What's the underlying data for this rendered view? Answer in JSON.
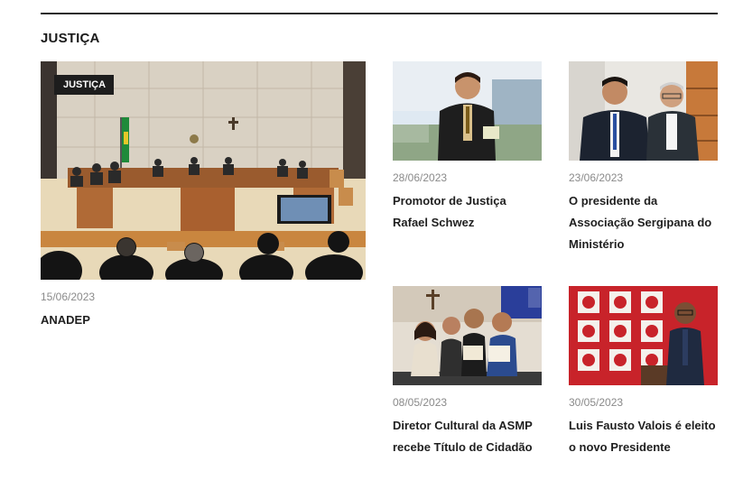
{
  "section": {
    "title": "JUSTIÇA"
  },
  "featured": {
    "badge": "JUSTIÇA",
    "date": "15/06/2023",
    "title": "ANADEP"
  },
  "articles": [
    {
      "date": "28/06/2023",
      "title_line1": "Promotor de Justiça",
      "title_line2": "Rafael Schwez",
      "title_line3": ""
    },
    {
      "date": "23/06/2023",
      "title_line1": "O presidente da",
      "title_line2": "Associação Sergipana do",
      "title_line3": "Ministério"
    },
    {
      "date": "08/05/2023",
      "title_line1": "Diretor Cultural da ASMP",
      "title_line2": "recebe Título de Cidadão",
      "title_line3": ""
    },
    {
      "date": "30/05/2023",
      "title_line1": "Luis Fausto Valois é eleito",
      "title_line2": "o novo Presidente",
      "title_line3": ""
    }
  ],
  "colors": {
    "rule": "#2b2b2b",
    "badge_bg": "#1d1d1d",
    "date": "#8a8a8a",
    "title": "#1f1f1f"
  }
}
